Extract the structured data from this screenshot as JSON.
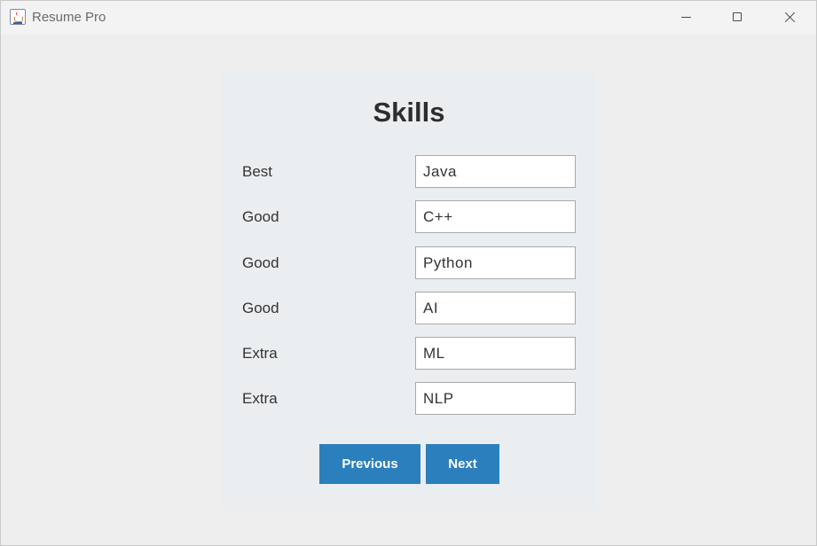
{
  "window": {
    "title": "Resume Pro",
    "app_icon": "java-cup-icon",
    "controls": [
      "minimize-icon",
      "maximize-icon",
      "close-icon"
    ]
  },
  "form": {
    "title": "Skills",
    "rows": [
      {
        "label": "Best",
        "value": "Java"
      },
      {
        "label": "Good",
        "value": "C++"
      },
      {
        "label": "Good",
        "value": "Python"
      },
      {
        "label": "Good",
        "value": "AI"
      },
      {
        "label": "Extra",
        "value": "ML"
      },
      {
        "label": "Extra",
        "value": "NLP"
      }
    ],
    "previous_label": "Previous",
    "next_label": "Next"
  },
  "colors": {
    "button_bg": "#2b7fbd",
    "button_text": "#ffffff",
    "panel_bg": "#ebeef0",
    "window_bg": "#eeeeee"
  }
}
